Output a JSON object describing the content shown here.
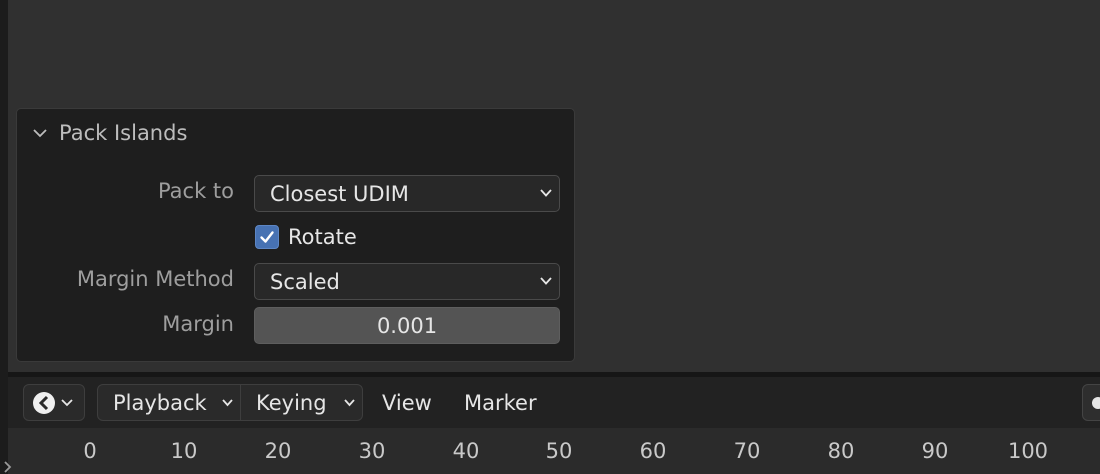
{
  "panel": {
    "title": "Pack Islands",
    "pack_to": {
      "label": "Pack to",
      "value": "Closest UDIM"
    },
    "rotate": {
      "label": "Rotate",
      "checked": true
    },
    "margin_method": {
      "label": "Margin Method",
      "value": "Scaled"
    },
    "margin": {
      "label": "Margin",
      "value": "0.001"
    }
  },
  "timeline": {
    "menus": {
      "playback": "Playback",
      "keying": "Keying",
      "view": "View",
      "marker": "Marker"
    },
    "ruler": [
      "0",
      "10",
      "20",
      "30",
      "40",
      "50",
      "60",
      "70",
      "80",
      "90",
      "100"
    ]
  },
  "colors": {
    "accent": "#4772b3",
    "panel_bg": "#1e1e1e",
    "editor_bg": "#303030"
  },
  "icons": [
    "chevron-down-icon",
    "check-icon",
    "editor-type-icon",
    "record-dot-icon"
  ]
}
